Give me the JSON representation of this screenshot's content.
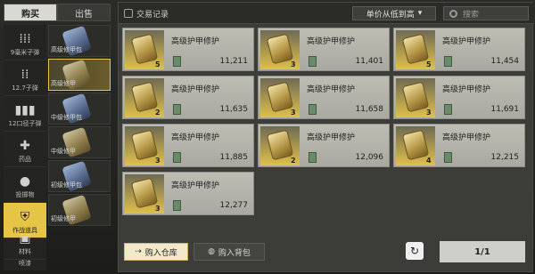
{
  "tabs": {
    "buy": "购买",
    "sell": "出售"
  },
  "categories": [
    {
      "label": "9毫米子弹",
      "icon": "bullets-9mm-icon"
    },
    {
      "label": "12.7子弹",
      "icon": "bullets-127-icon"
    },
    {
      "label": "12口径子弹",
      "icon": "shotgun-shells-icon"
    },
    {
      "label": "药品",
      "icon": "medkit-icon"
    },
    {
      "label": "投掷物",
      "icon": "grenade-icon"
    },
    {
      "label": "作战道具",
      "icon": "shield-plus-icon",
      "active": true
    },
    {
      "label": "材料",
      "icon": "materials-icon"
    },
    {
      "label": "喷漆",
      "icon": "spray-icon"
    }
  ],
  "subcategories": [
    {
      "label": "高级修甲包",
      "variant": "blue"
    },
    {
      "label": "高级修甲",
      "variant": "gold",
      "active": true
    },
    {
      "label": "中级修甲包",
      "variant": "blue"
    },
    {
      "label": "中级修甲",
      "variant": "gold"
    },
    {
      "label": "初级修甲包",
      "variant": "blue"
    },
    {
      "label": "初级修甲",
      "variant": "gold"
    }
  ],
  "toolbar": {
    "trade_record": "交易记录",
    "sort_label": "单价从低到高",
    "search_placeholder": "搜索"
  },
  "listings": [
    {
      "name": "高级护甲修护",
      "qty": "5",
      "price": "11,211"
    },
    {
      "name": "高级护甲修护",
      "qty": "3",
      "price": "11,401"
    },
    {
      "name": "高级护甲修护",
      "qty": "5",
      "price": "11,454"
    },
    {
      "name": "高级护甲修护",
      "qty": "2",
      "price": "11,635"
    },
    {
      "name": "高级护甲修护",
      "qty": "3",
      "price": "11,658"
    },
    {
      "name": "高级护甲修护",
      "qty": "3",
      "price": "11,691"
    },
    {
      "name": "高级护甲修护",
      "qty": "3",
      "price": "11,885"
    },
    {
      "name": "高级护甲修护",
      "qty": "2",
      "price": "12,096"
    },
    {
      "name": "高级护甲修护",
      "qty": "4",
      "price": "12,215"
    },
    {
      "name": "高级护甲修护",
      "qty": "3",
      "price": "12,277"
    }
  ],
  "actions": {
    "buy_to_warehouse": "购入仓库",
    "buy_to_backpack": "购入背包",
    "refresh_icon": "refresh-icon"
  },
  "pagination": {
    "text": "1/1"
  },
  "colors": {
    "accent": "#e6c445",
    "card_bg": "#b3b3ab"
  }
}
